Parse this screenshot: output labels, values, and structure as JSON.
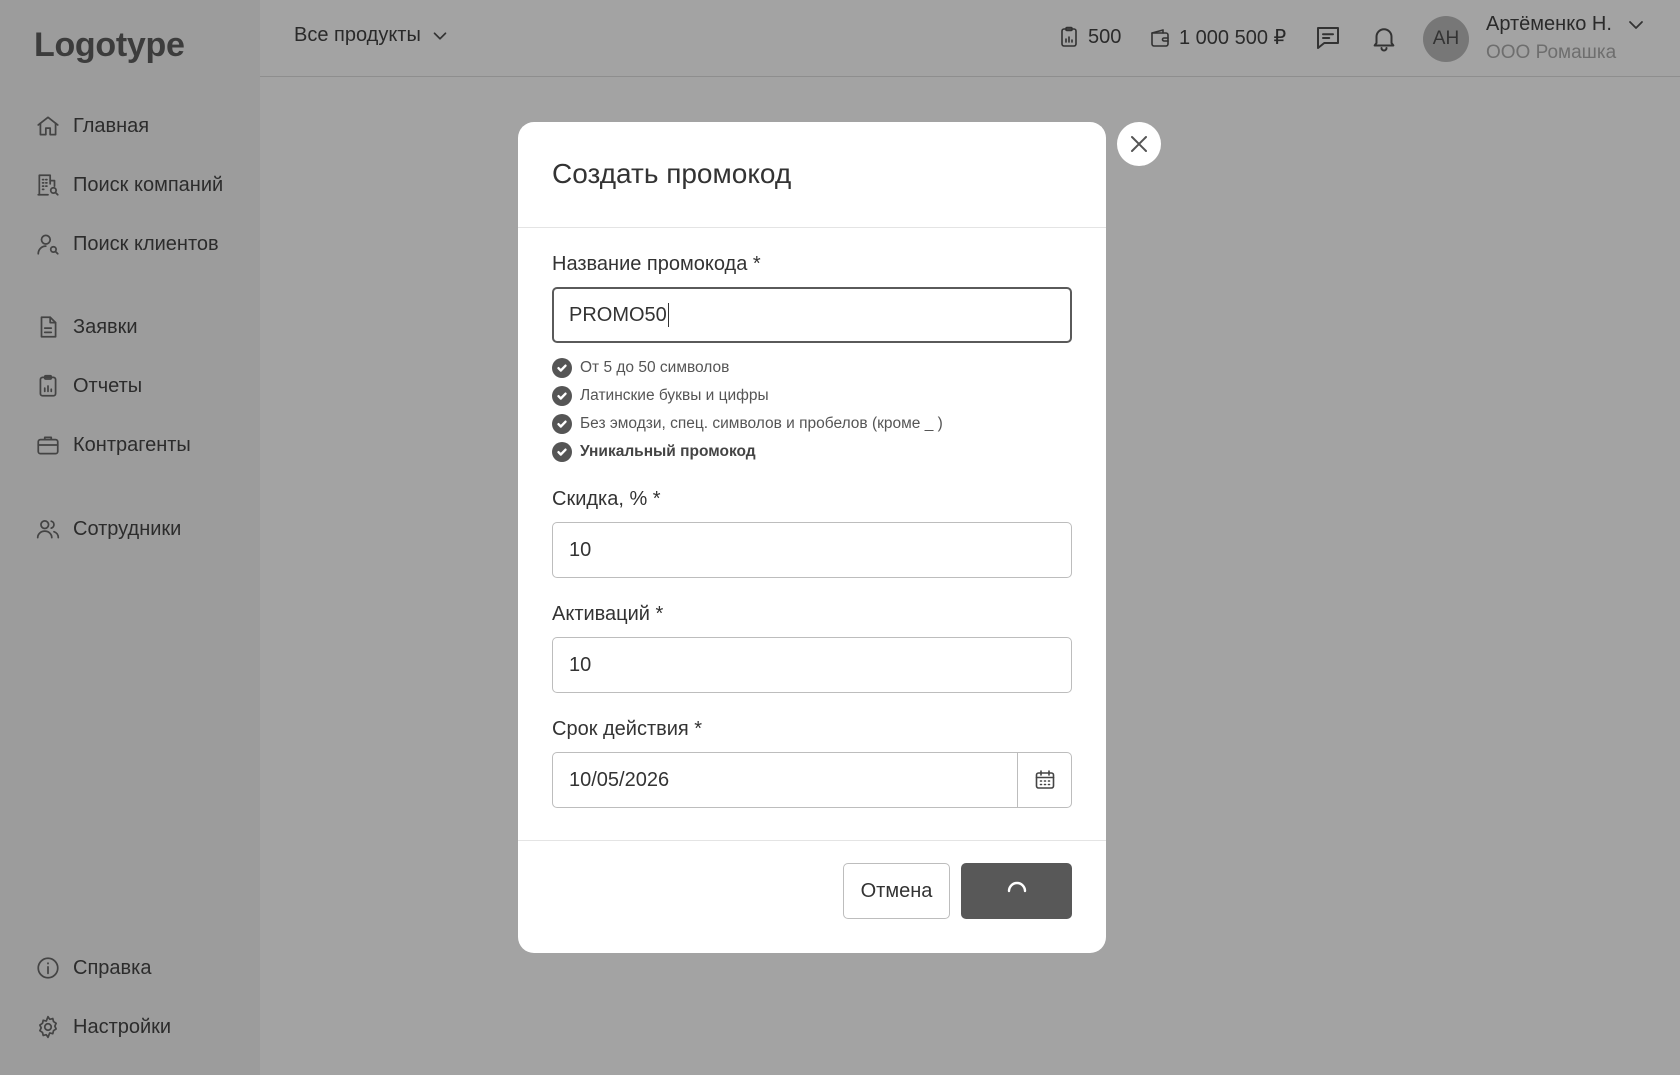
{
  "sidebar": {
    "logo": "Logotype",
    "items": [
      {
        "label": "Главная",
        "icon": "home-icon"
      },
      {
        "label": "Поиск компаний",
        "icon": "building-search-icon"
      },
      {
        "label": "Поиск клиентов",
        "icon": "user-search-icon"
      },
      {
        "label": "Заявки",
        "icon": "document-icon"
      },
      {
        "label": "Отчеты",
        "icon": "clipboard-chart-icon"
      },
      {
        "label": "Контрагенты",
        "icon": "briefcase-icon"
      },
      {
        "label": "Сотрудники",
        "icon": "users-icon"
      },
      {
        "label": "Справка",
        "icon": "info-icon"
      },
      {
        "label": "Настройки",
        "icon": "gear-icon"
      }
    ]
  },
  "header": {
    "products_label": "Все продукты",
    "reports_count": "500",
    "balance": "1 000 500 ₽",
    "user": {
      "initials": "АН",
      "name": "Артёменко Н.",
      "org": "ООО Ромашка"
    }
  },
  "modal": {
    "title": "Создать промокод",
    "name_field": {
      "label": "Название промокода *",
      "value": "PROMO50"
    },
    "rules": [
      "От 5 до 50 символов",
      "Латинские буквы и цифры",
      "Без эмодзи, спец. символов и пробелов (кроме _ )",
      "Уникальный промокод"
    ],
    "discount_field": {
      "label": "Скидка, % *",
      "value": "10"
    },
    "activations_field": {
      "label": "Активаций *",
      "value": "10"
    },
    "expiry_field": {
      "label": "Срок действия *",
      "value": "10/05/2026"
    },
    "cancel_label": "Отмена",
    "submit_state": "loading"
  }
}
